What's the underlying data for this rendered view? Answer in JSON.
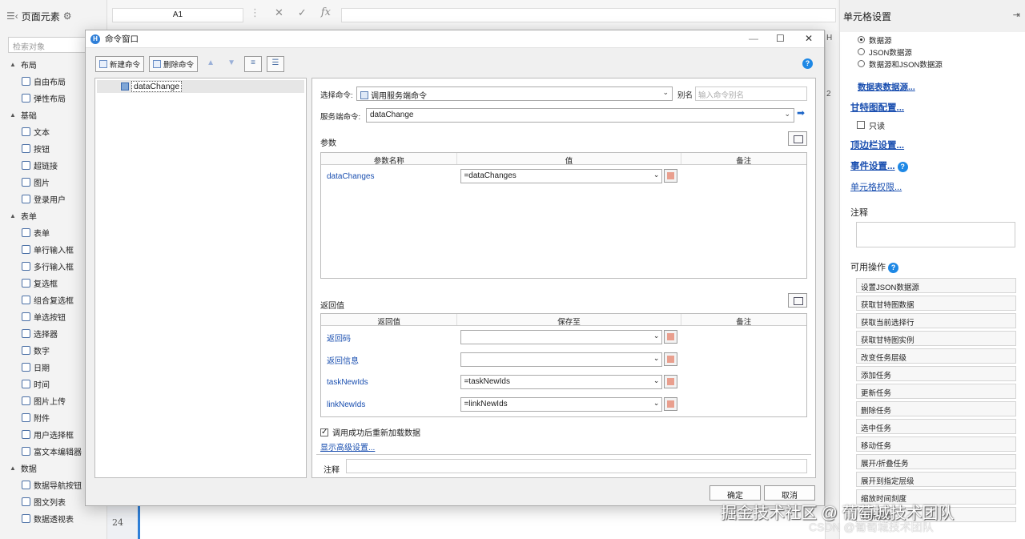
{
  "left_panel": {
    "title": "页面元素",
    "search_placeholder": "检索对象",
    "groups": [
      {
        "label": "布局",
        "items": [
          "自由布局",
          "弹性布局"
        ]
      },
      {
        "label": "基础",
        "items": [
          "文本",
          "按钮",
          "超链接",
          "图片",
          "登录用户"
        ]
      },
      {
        "label": "表单",
        "items": [
          "表单",
          "单行输入框",
          "多行输入框",
          "复选框",
          "组合复选框",
          "单选按钮",
          "选择器",
          "数字",
          "日期",
          "时间",
          "图片上传",
          "附件",
          "用户选择框",
          "富文本编辑器"
        ]
      },
      {
        "label": "数据",
        "items": [
          "数据导航按钮",
          "图文列表",
          "数据透视表"
        ]
      }
    ]
  },
  "sheet": {
    "cell_ref": "A1",
    "fx_symbol": "fx",
    "cancel_symbol": "✕",
    "confirm_symbol": "✓",
    "row_label": "24",
    "col_label": "H",
    "row2_label": "2"
  },
  "right_panel": {
    "title": "单元格设置",
    "radios": [
      {
        "label": "数据源",
        "checked": true
      },
      {
        "label": "JSON数据源",
        "checked": false
      },
      {
        "label": "数据源和JSON数据源",
        "checked": false
      }
    ],
    "datasource_link": "数据表数据源...",
    "gantt_link": "甘特图配置...",
    "readonly_label": "只读",
    "toolbar_link": "顶边栏设置...",
    "event_link": "事件设置...",
    "permission_link": "单元格权限...",
    "notes_label": "注释",
    "ops_label": "可用操作",
    "operations": [
      "设置JSON数据源",
      "获取甘特图数据",
      "获取当前选择行",
      "获取甘特图实例",
      "改变任务层级",
      "添加任务",
      "更新任务",
      "删除任务",
      "选中任务",
      "移动任务",
      "展开/折叠任务",
      "展开到指定层级",
      "缩放时间刻度",
      "刷新图表"
    ]
  },
  "dialog": {
    "title": "命令窗口",
    "new_cmd": "新建命令",
    "del_cmd": "删除命令",
    "tree_item": "dataChange",
    "select_cmd_label": "选择命令:",
    "select_cmd_value": "调用服务端命令",
    "alias_label": "别名",
    "alias_placeholder": "输入命令别名",
    "server_cmd_label": "服务端命令:",
    "server_cmd_value": "dataChange",
    "params_title": "参数",
    "params_headers": [
      "参数名称",
      "值",
      "备注"
    ],
    "params_rows": [
      {
        "name": "dataChanges",
        "value": "=dataChanges"
      }
    ],
    "returns_title": "返回值",
    "returns_headers": [
      "返回值",
      "保存至",
      "备注"
    ],
    "returns_rows": [
      {
        "name": "返回码",
        "value": ""
      },
      {
        "name": "返回信息",
        "value": ""
      },
      {
        "name": "taskNewIds",
        "value": "=taskNewIds"
      },
      {
        "name": "linkNewIds",
        "value": "=linkNewIds"
      }
    ],
    "reload_label": "调用成功后重新加载数据",
    "reload_checked": true,
    "adv_link": "显示高级设置...",
    "note_label": "注释",
    "ok": "确定",
    "cancel": "取消"
  },
  "watermark": {
    "main": "掘金技术社区 @ 葡萄城技术团队",
    "sub": "CSDN @葡萄城技术团队"
  },
  "colors": {
    "accent": "#1a4fb0",
    "help": "#1e88e5",
    "row_marker": "#2f7fd8"
  }
}
